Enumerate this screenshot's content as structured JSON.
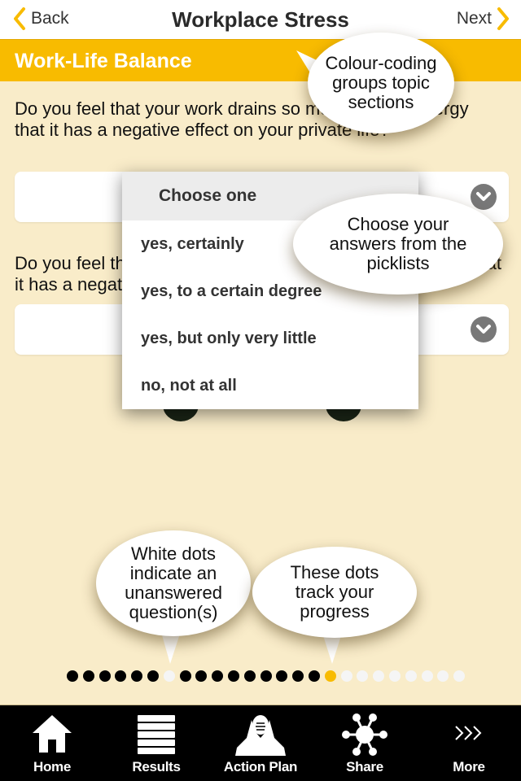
{
  "header": {
    "back_label": "Back",
    "title": "Workplace Stress",
    "next_label": "Next",
    "accent_color": "#f8bb00"
  },
  "section": {
    "label": "Work-Life Balance",
    "color": "#f8bb00"
  },
  "questions": [
    {
      "text": "Do you feel that your work drains so much of your energy that it has a negative effect on your private life?",
      "value": ""
    },
    {
      "text": "Do you feel that your work takes up so much of your time that it has a negative effect on your private life?",
      "value": ""
    }
  ],
  "picker": {
    "placeholder": "Choose one",
    "options": [
      "yes, certainly",
      "yes, to a certain degree",
      "yes, but only very little",
      "no, not at all"
    ]
  },
  "callouts": {
    "colour_coding": [
      "Colour-coding",
      "groups topic",
      "sections"
    ],
    "picklists": [
      "Choose your",
      "answers from the",
      "picklists"
    ],
    "white_dots": [
      "White dots",
      "indicate an",
      "unanswered",
      "question(s)"
    ],
    "track_dots": [
      "These dots",
      "track your",
      "progress"
    ]
  },
  "progress": {
    "total": 25,
    "current_index": 16,
    "states": [
      "answered",
      "answered",
      "answered",
      "answered",
      "answered",
      "answered",
      "unanswered",
      "answered",
      "answered",
      "answered",
      "answered",
      "answered",
      "answered",
      "answered",
      "answered",
      "answered",
      "current",
      "unanswered",
      "unanswered",
      "unanswered",
      "unanswered",
      "unanswered",
      "unanswered",
      "unanswered",
      "unanswered"
    ]
  },
  "tabbar": {
    "items": [
      {
        "label": "Home",
        "icon": "home-icon"
      },
      {
        "label": "Results",
        "icon": "list-icon"
      },
      {
        "label": "Action Plan",
        "icon": "stressed-person-icon"
      },
      {
        "label": "Share",
        "icon": "share-network-icon"
      },
      {
        "label": "More",
        "icon": "more-chevrons-icon"
      }
    ]
  }
}
